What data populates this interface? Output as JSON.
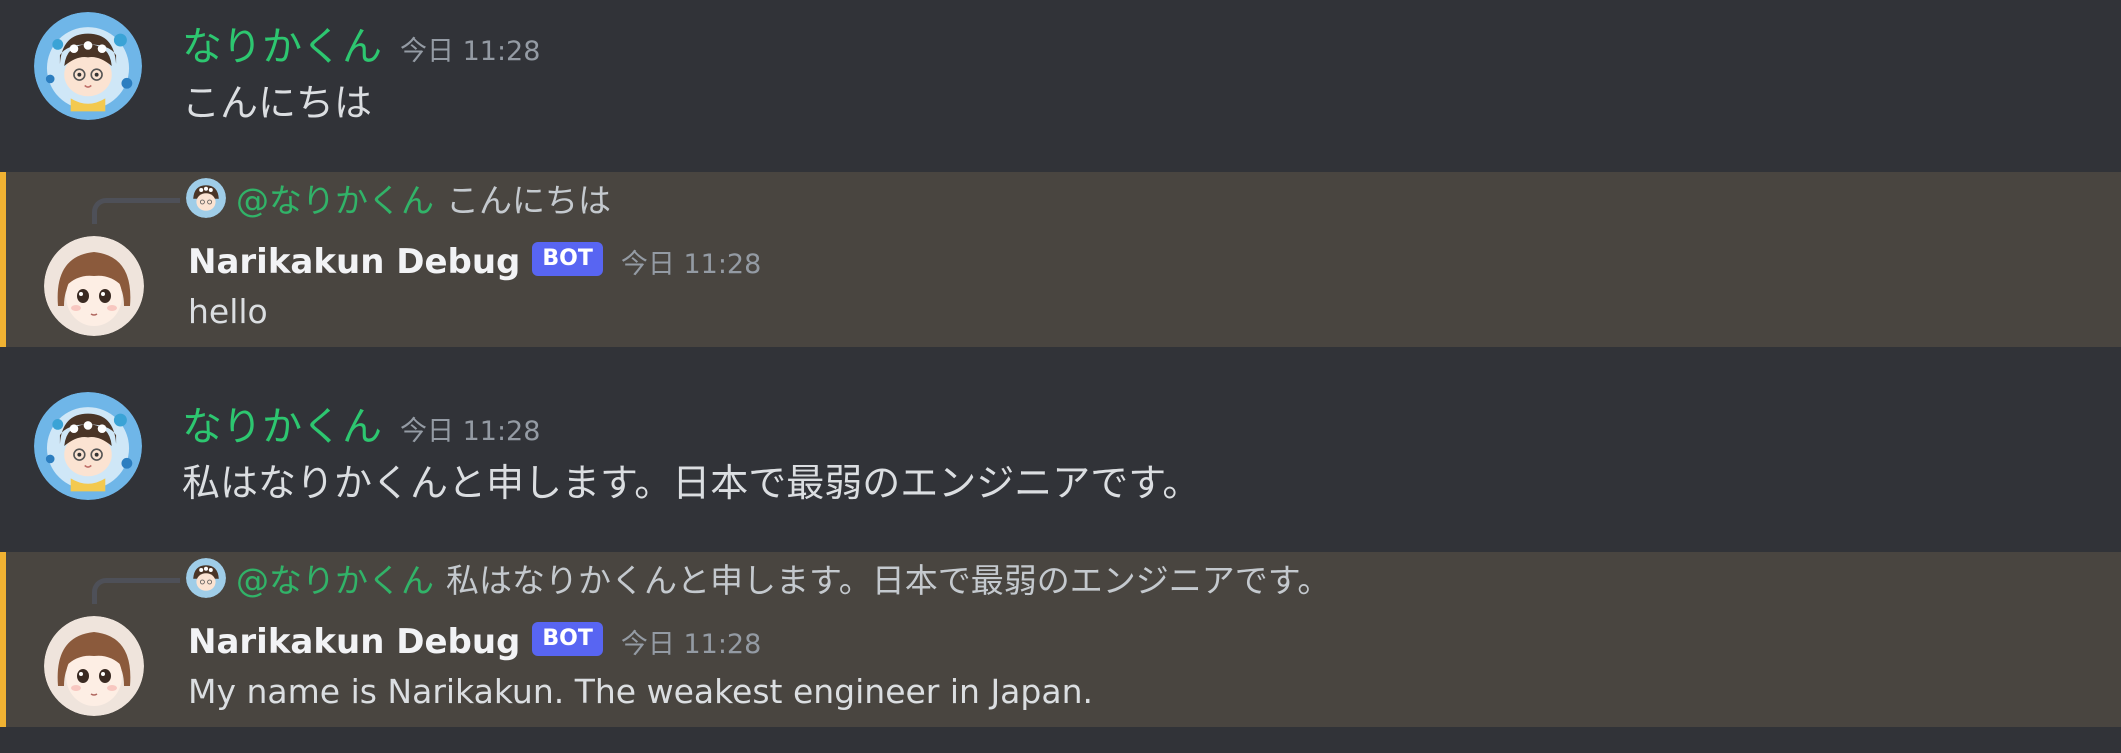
{
  "messages": [
    {
      "author": "なりかくん",
      "timestamp": "今日 11:28",
      "content": "こんにちは"
    },
    {
      "author": "Narikakun Debug",
      "bot_tag": "BOT",
      "timestamp": "今日 11:28",
      "content": "hello",
      "reply": {
        "mention": "@なりかくん",
        "text": "こんにちは"
      }
    },
    {
      "author": "なりかくん",
      "timestamp": "今日 11:28",
      "content": "私はなりかくんと申します。日本で最弱のエンジニアです。"
    },
    {
      "author": "Narikakun Debug",
      "bot_tag": "BOT",
      "timestamp": "今日 11:28",
      "content": "My name is Narikakun. The weakest engineer in Japan.",
      "reply": {
        "mention": "@なりかくん",
        "text": "私はなりかくんと申します。日本で最弱のエンジニアです。"
      }
    }
  ],
  "colors": {
    "background": "#313338",
    "mention_highlight": "#494540",
    "mention_bar": "#f0b232",
    "user_name": "#2dc770",
    "bot_tag": "#5865f2"
  }
}
